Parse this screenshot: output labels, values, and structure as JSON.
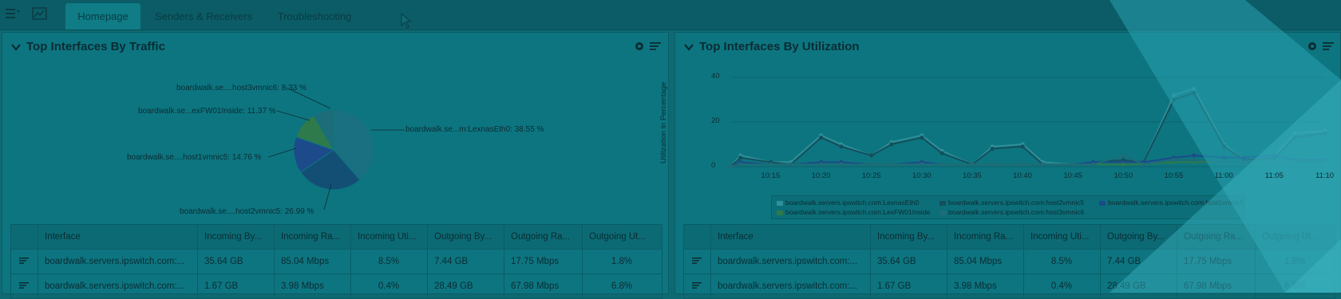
{
  "tabs": [
    {
      "label": "Homepage",
      "active": true
    },
    {
      "label": "Senders & Receivers",
      "active": false
    },
    {
      "label": "Troubleshooting",
      "active": false
    }
  ],
  "icons": {
    "menu": "hamburger-menu-icon",
    "dashboard": "dashboard-icon",
    "cursor": "mouse-pointer-icon",
    "settings": "gear-icon",
    "options": "list-options-icon",
    "collapse": "chevron-down-icon",
    "row": "row-menu-icon"
  },
  "colors": {
    "background": "#0e6a72",
    "panel": "#0d7580",
    "accent": "#0f7c86",
    "slice_1": "#1a6f80",
    "slice_2": "#134f75",
    "slice_3": "#1c4a8a",
    "slice_4": "#2e7a4a",
    "slice_5": "#1d6c7a"
  },
  "panel_left": {
    "title": "Top Interfaces By Traffic",
    "pie_labels": {
      "host3": "boardwalk.se....host3vmnic6: 8.33 %",
      "fw01": "boardwalk.se...exFW01Inside: 11.37 %",
      "lexnas": "boardwalk.se...m:LexnasEth0: 38.55 %",
      "host1": "boardwalk.se....host1vmnic5: 14.76 %",
      "host2": "boardwalk.se....host2vmnic5: 26.99 %"
    },
    "table": {
      "columns": [
        "Interface",
        "Incoming By...",
        "Incoming Ra...",
        "Incoming Uti...",
        "Outgoing By...",
        "Outgoing Ra...",
        "Outgoing Ut..."
      ],
      "rows": [
        [
          "boardwalk.servers.ipswitch.com:...",
          "35.64 GB",
          "85.04 Mbps",
          "8.5%",
          "7.44 GB",
          "17.75 Mbps",
          "1.8%"
        ],
        [
          "boardwalk.servers.ipswitch.com:...",
          "1.67 GB",
          "3.98 Mbps",
          "0.4%",
          "28.49 GB",
          "67.98 Mbps",
          "6.8%"
        ]
      ]
    }
  },
  "panel_right": {
    "title": "Top Interfaces By Utilization",
    "legend": {
      "item1": "boardwalk.servers.ipswitch.com:LexnasEth0",
      "item2": "boardwalk.servers.ipswitch.com:host2vmnic5",
      "item3": "boardwalk.servers.ipswitch.com:host1vmnic5",
      "item4": "boardwalk.servers.ipswitch.com:LexFW01Inside",
      "item5": "boardwalk.servers.ipswitch.com:host3vmnic6"
    },
    "table": {
      "columns": [
        "Interface",
        "Incoming By...",
        "Incoming Ra...",
        "Incoming Uti...",
        "Outgoing By...",
        "Outgoing Ra...",
        "Outgoing Ut..."
      ],
      "rows": [
        [
          "boardwalk.servers.ipswitch.com:...",
          "35.64 GB",
          "85.04 Mbps",
          "8.5%",
          "7.44 GB",
          "17.75 Mbps",
          "1.8%"
        ],
        [
          "boardwalk.servers.ipswitch.com:...",
          "1.67 GB",
          "3.98 Mbps",
          "0.4%",
          "28.49 GB",
          "67.98 Mbps",
          "6.8%"
        ]
      ]
    }
  },
  "chart_data": [
    {
      "type": "pie",
      "slices": [
        {
          "label": "boardwalk.se...m:LexnasEth0",
          "value": 38.55
        },
        {
          "label": "boardwalk.se....host2vmnic5",
          "value": 26.99
        },
        {
          "label": "boardwalk.se....host1vmnic5",
          "value": 14.76
        },
        {
          "label": "boardwalk.se...exFW01Inside",
          "value": 11.37
        },
        {
          "label": "boardwalk.se....host3vmnic6",
          "value": 8.33
        }
      ]
    },
    {
      "type": "line",
      "ylabel": "Utilization in Percentage",
      "ylim": [
        0,
        40
      ],
      "yticks": [
        0,
        20,
        40
      ],
      "xticks": [
        "10:15",
        "10:20",
        "10:25",
        "10:30",
        "10:35",
        "10:40",
        "10:45",
        "10:50",
        "10:55",
        "11:00",
        "11:05",
        "11:10"
      ],
      "x": [
        "10:11",
        "10:12",
        "10:15",
        "10:17",
        "10:20",
        "10:22",
        "10:25",
        "10:27",
        "10:30",
        "10:32",
        "10:35",
        "10:37",
        "10:40",
        "10:42",
        "10:45",
        "10:47",
        "10:50",
        "10:52",
        "10:55",
        "10:57",
        "11:00",
        "11:02",
        "11:05",
        "11:07",
        "11:10"
      ],
      "series": [
        {
          "name": "boardwalk.servers.ipswitch.com:LexnasEth0",
          "values": [
            0,
            5,
            2,
            2,
            14,
            10,
            5,
            11,
            14,
            7,
            1,
            9,
            10,
            2,
            1,
            2,
            3,
            2,
            32,
            35,
            10,
            3,
            5,
            15,
            16
          ]
        },
        {
          "name": "boardwalk.servers.ipswitch.com:host2vmnic5",
          "values": [
            0,
            4,
            2,
            1,
            13,
            9,
            5,
            10,
            13,
            6,
            1,
            8,
            9,
            1,
            1,
            2,
            3,
            2,
            30,
            33,
            9,
            3,
            4,
            13,
            15
          ]
        },
        {
          "name": "boardwalk.servers.ipswitch.com:host1vmnic5",
          "values": [
            0,
            2,
            1,
            1,
            2,
            2,
            1,
            1,
            2,
            1,
            1,
            1,
            1,
            1,
            1,
            2,
            2,
            2,
            4,
            5,
            4,
            4,
            5,
            3,
            3
          ]
        },
        {
          "name": "boardwalk.servers.ipswitch.com:LexFW01Inside",
          "values": [
            0,
            1,
            1,
            1,
            1,
            1,
            1,
            1,
            1,
            1,
            1,
            1,
            1,
            1,
            1,
            1,
            1,
            1,
            2,
            2,
            2,
            2,
            2,
            2,
            2
          ]
        },
        {
          "name": "boardwalk.servers.ipswitch.com:host3vmnic6",
          "values": [
            0,
            1,
            1,
            1,
            1,
            1,
            1,
            1,
            1,
            1,
            1,
            1,
            1,
            1,
            1,
            1,
            5,
            1,
            3,
            3,
            2,
            2,
            2,
            2,
            2
          ]
        }
      ]
    }
  ]
}
